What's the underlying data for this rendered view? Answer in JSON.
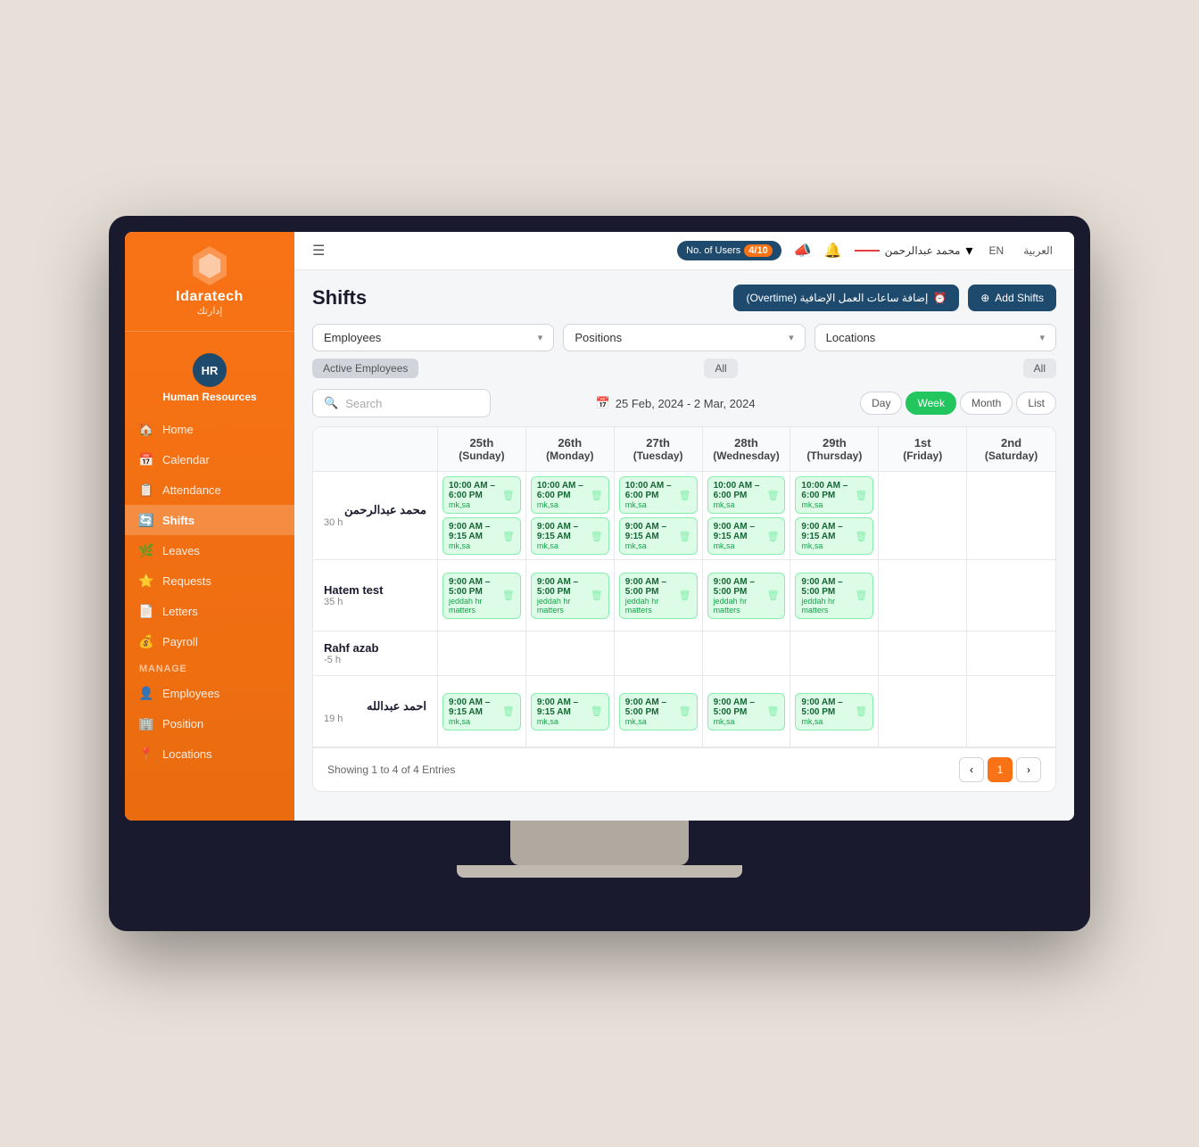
{
  "app": {
    "name": "Idaratech",
    "name_arabic": "إدارتك",
    "module": "Human Resources"
  },
  "topbar": {
    "users_label": "No. of Users",
    "users_count": "4/10",
    "user_name": "محمد عبدالرحمن",
    "lang_en": "EN",
    "lang_ar": "العربية"
  },
  "sidebar": {
    "hr_badge": "HR",
    "nav_items": [
      {
        "id": "home",
        "label": "Home",
        "icon": "🏠"
      },
      {
        "id": "calendar",
        "label": "Calendar",
        "icon": "📅"
      },
      {
        "id": "attendance",
        "label": "Attendance",
        "icon": "📋"
      },
      {
        "id": "shifts",
        "label": "Shifts",
        "icon": "🔄"
      },
      {
        "id": "leaves",
        "label": "Leaves",
        "icon": "🌿"
      },
      {
        "id": "requests",
        "label": "Requests",
        "icon": "⭐"
      },
      {
        "id": "letters",
        "label": "Letters",
        "icon": "📄"
      },
      {
        "id": "payroll",
        "label": "Payroll",
        "icon": "💰"
      }
    ],
    "manage_label": "MANAGE",
    "manage_items": [
      {
        "id": "employees",
        "label": "Employees",
        "icon": "👤"
      },
      {
        "id": "position",
        "label": "Position",
        "icon": "🏢"
      },
      {
        "id": "locations",
        "label": "Locations",
        "icon": "📍"
      }
    ]
  },
  "page": {
    "title": "Shifts",
    "btn_overtime": "إضافة ساعات العمل الإضافية (Overtime)",
    "btn_add_shifts": "+ Add Shifts"
  },
  "filters": {
    "employees_label": "Employees",
    "positions_label": "Positions",
    "locations_label": "Locations",
    "tag_active": "Active Employees",
    "tag_all_1": "All",
    "tag_all_2": "All"
  },
  "calendar": {
    "search_placeholder": "Search",
    "date_range": "25 Feb, 2024 - 2 Mar, 2024",
    "cal_icon": "📅",
    "views": [
      "Day",
      "Week",
      "Month",
      "List"
    ],
    "active_view": "Week"
  },
  "table": {
    "columns": [
      {
        "id": "employee",
        "label": ""
      },
      {
        "id": "sun",
        "day": "25th",
        "day_name": "(Sunday)"
      },
      {
        "id": "mon",
        "day": "26th",
        "day_name": "(Monday)"
      },
      {
        "id": "tue",
        "day": "27th",
        "day_name": "(Tuesday)"
      },
      {
        "id": "wed",
        "day": "28th",
        "day_name": "(Wednesday)"
      },
      {
        "id": "thu",
        "day": "29th",
        "day_name": "(Thursday)"
      },
      {
        "id": "fri",
        "day": "1st",
        "day_name": "(Friday)"
      },
      {
        "id": "sat",
        "day": "2nd",
        "day_name": "(Saturday)"
      }
    ],
    "rows": [
      {
        "id": "row1",
        "name": "محمد عبدالرحمن",
        "hours": "30 h",
        "shifts": [
          [
            {
              "time": "10:00 AM – 6:00 PM",
              "loc": "mk,sa",
              "show": true
            },
            {
              "time": "9:00 AM – 9:15 AM",
              "loc": "mk,sa",
              "show": true
            }
          ],
          [
            {
              "time": "10:00 AM – 6:00 PM",
              "loc": "mk,sa",
              "show": true
            },
            {
              "time": "9:00 AM – 9:15 AM",
              "loc": "mk,sa",
              "show": true
            }
          ],
          [
            {
              "time": "10:00 AM – 6:00 PM",
              "loc": "mk,sa",
              "show": true
            },
            {
              "time": "9:00 AM – 9:15 AM",
              "loc": "mk,sa",
              "show": true
            }
          ],
          [
            {
              "time": "10:00 AM – 6:00 PM",
              "loc": "mk,sa",
              "show": true
            },
            {
              "time": "9:00 AM – 9:15 AM",
              "loc": "mk,sa",
              "show": true
            }
          ],
          [
            {
              "time": "10:00 AM – 6:00 PM",
              "loc": "mk,sa",
              "show": true
            },
            {
              "time": "9:00 AM – 9:15 AM",
              "loc": "mk,sa",
              "show": true
            }
          ],
          [],
          []
        ]
      },
      {
        "id": "row2",
        "name": "Hatem test",
        "hours": "35 h",
        "shifts": [
          [
            {
              "time": "9:00 AM – 5:00 PM",
              "loc": "jeddah hr matters",
              "show": true
            }
          ],
          [
            {
              "time": "9:00 AM – 5:00 PM",
              "loc": "jeddah hr matters",
              "show": true
            }
          ],
          [
            {
              "time": "9:00 AM – 5:00 PM",
              "loc": "jeddah hr matters",
              "show": true
            }
          ],
          [
            {
              "time": "9:00 AM – 5:00 PM",
              "loc": "jeddah hr matters",
              "show": true
            }
          ],
          [
            {
              "time": "9:00 AM – 5:00 PM",
              "loc": "jeddah hr matters",
              "show": true
            }
          ],
          [],
          []
        ]
      },
      {
        "id": "row3",
        "name": "Rahf azab",
        "hours": "-5 h",
        "shifts": [
          [],
          [],
          [],
          [],
          [],
          [],
          []
        ]
      },
      {
        "id": "row4",
        "name": "احمد عبدالله",
        "hours": "19 h",
        "shifts": [
          [
            {
              "time": "9:00 AM – 9:15 AM",
              "loc": "mk,sa",
              "show": true
            }
          ],
          [
            {
              "time": "9:00 AM – 9:15 AM",
              "loc": "mk,sa",
              "show": true
            }
          ],
          [
            {
              "time": "9:00 AM – 5:00 PM",
              "loc": "mk,sa",
              "show": true
            }
          ],
          [
            {
              "time": "9:00 AM – 5:00 PM",
              "loc": "mk,sa",
              "show": true
            }
          ],
          [
            {
              "time": "9:00 AM – 5:00 PM",
              "loc": "mk,sa",
              "show": true
            }
          ],
          [],
          []
        ]
      }
    ],
    "pagination_info": "Showing 1 to 4 of 4 Entries"
  }
}
